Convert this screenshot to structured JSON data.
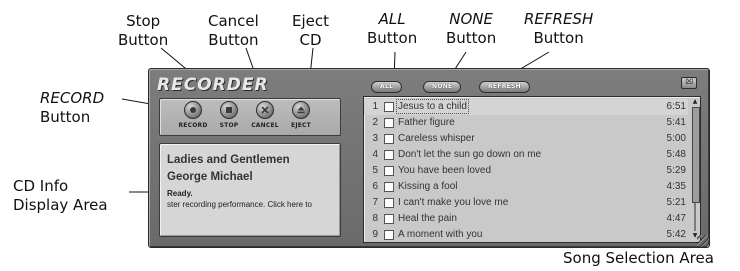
{
  "callouts": {
    "stop": [
      "Stop",
      "Button"
    ],
    "cancel": [
      "Cancel",
      "Button"
    ],
    "eject": [
      "Eject",
      "CD"
    ],
    "all": [
      "ALL",
      "Button"
    ],
    "none": [
      "NONE",
      "Button"
    ],
    "refresh": [
      "REFRESH",
      "Button"
    ],
    "record": [
      "RECORD",
      "Button"
    ],
    "cd_info": [
      "CD Info",
      "Display Area"
    ],
    "song_area": "Song Selection Area"
  },
  "app": {
    "title": "RECORDER",
    "close_glyph": "☒"
  },
  "controls": [
    {
      "label": "RECORD"
    },
    {
      "label": "STOP"
    },
    {
      "label": "CANCEL"
    },
    {
      "label": "EJECT"
    }
  ],
  "info": {
    "line1": "Ladies and Gentlemen",
    "line2": "George Michael",
    "status": "Ready.",
    "ticker": "ster recording performance.  Click here to"
  },
  "toolbar": {
    "all_label": "ALL",
    "none_label": "NONE",
    "refresh_label": "REFRESH"
  },
  "songs": [
    {
      "num": "1",
      "name": "Jesus to a child",
      "dur": "6:51",
      "selected": true
    },
    {
      "num": "2",
      "name": "Father figure",
      "dur": "5:41"
    },
    {
      "num": "3",
      "name": "Careless whisper",
      "dur": "5:00"
    },
    {
      "num": "4",
      "name": "Don't let the sun go down on me",
      "dur": "5:48"
    },
    {
      "num": "5",
      "name": "You have been loved",
      "dur": "5:29"
    },
    {
      "num": "6",
      "name": "Kissing a fool",
      "dur": "4:35"
    },
    {
      "num": "7",
      "name": "I can't make you love me",
      "dur": "5:21"
    },
    {
      "num": "8",
      "name": "Heal the pain",
      "dur": "4:47"
    },
    {
      "num": "9",
      "name": "A moment with you",
      "dur": "5:42"
    }
  ]
}
